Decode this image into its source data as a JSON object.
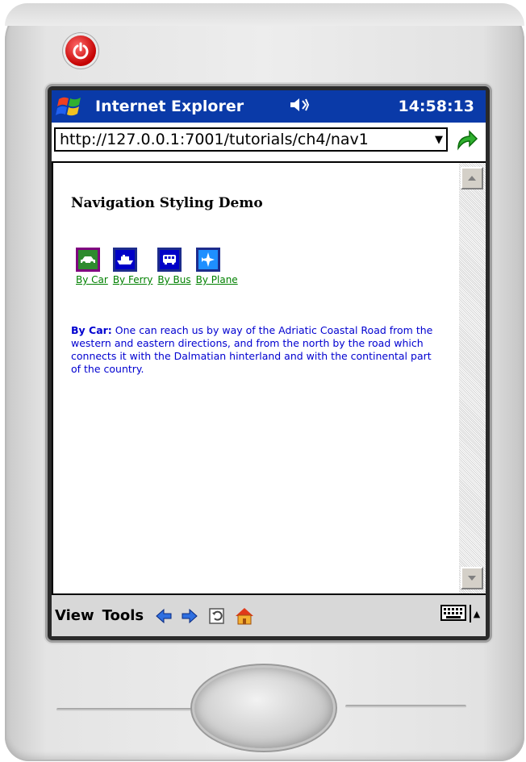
{
  "window": {
    "app_title": "Internet Explorer",
    "clock": "14:58:13"
  },
  "address_bar": {
    "url": "http://127.0.0.1:7001/tutorials/ch4/nav1"
  },
  "page": {
    "title": "Navigation Styling Demo",
    "nav_items": [
      {
        "label": "By Car",
        "icon": "car-icon"
      },
      {
        "label": "By Ferry",
        "icon": "ferry-icon"
      },
      {
        "label": "By Bus",
        "icon": "bus-icon"
      },
      {
        "label": "By Plane",
        "icon": "plane-icon"
      }
    ],
    "description_heading": "By Car:",
    "description_body": "One can reach us by way of the Adriatic Coastal Road from the western and eastern directions, and from the north by the road which connects it with the Dalmatian hinterland and with the continental part of the country."
  },
  "menubar": {
    "view_label": "View",
    "tools_label": "Tools",
    "icons": [
      "back-icon",
      "forward-icon",
      "refresh-icon",
      "home-icon",
      "keyboard-icon"
    ]
  },
  "colors": {
    "titlebar": "#0a3aa8",
    "nav_link": "#008000",
    "description_text": "#0000d0"
  }
}
